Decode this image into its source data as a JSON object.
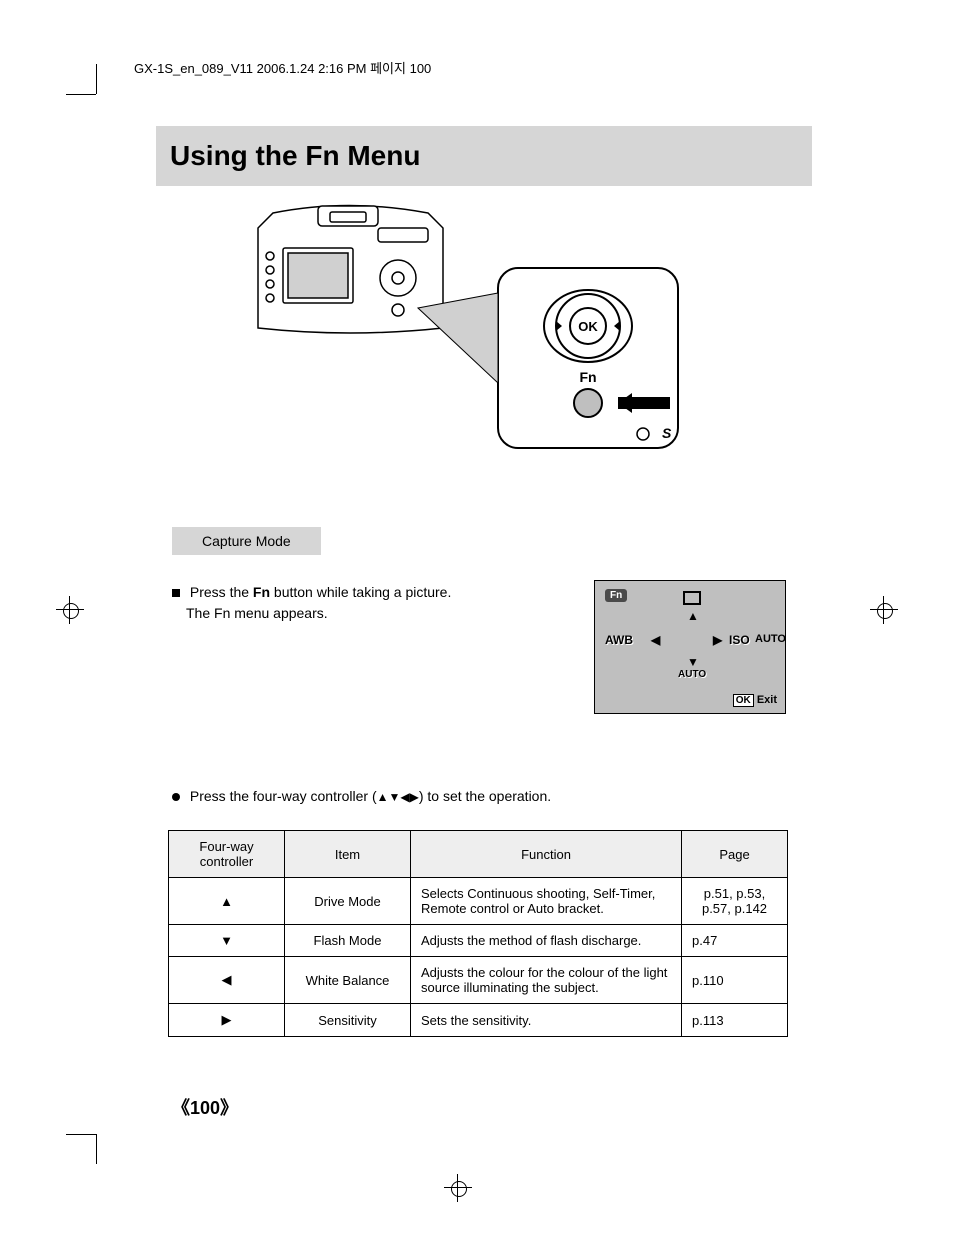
{
  "header": "GX-1S_en_089_V11  2006.1.24 2:16 PM 페이지 100",
  "title": "Using the Fn Menu",
  "subsection": "Capture Mode",
  "instruction1_prefix": "Press the ",
  "instruction1_fn": "Fn",
  "instruction1_suffix": " button while taking a picture.",
  "instruction1_line2": "The Fn menu appears.",
  "lcd": {
    "fn": "Fn",
    "awb": "AWB",
    "iso": "ISO",
    "auto": "AUTO",
    "auto2": "AUTO",
    "ok": "OK",
    "exit": "Exit"
  },
  "instruction2_prefix": "Press the four-way controller (",
  "instruction2_suffix": ") to set the operation.",
  "table": {
    "headers": [
      "Four-way controller",
      "Item",
      "Function",
      "Page"
    ],
    "rows": [
      {
        "dir": "▲",
        "item": "Drive Mode",
        "func": "Selects Continuous shooting, Self-Timer, Remote control or Auto bracket.",
        "page": "p.51, p.53, p.57, p.142"
      },
      {
        "dir": "▼",
        "item": "Flash Mode",
        "func": "Adjusts the method of flash discharge.",
        "page": "p.47"
      },
      {
        "dir": "◀",
        "item": "White Balance",
        "func": "Adjusts the colour for the colour of the light source illuminating the subject.",
        "page": "p.110"
      },
      {
        "dir": "▶",
        "item": "Sensitivity",
        "func": "Sets the sensitivity.",
        "page": "p.113"
      }
    ]
  },
  "callout": {
    "ok": "OK",
    "fn": "Fn"
  },
  "page_number": "《100》"
}
